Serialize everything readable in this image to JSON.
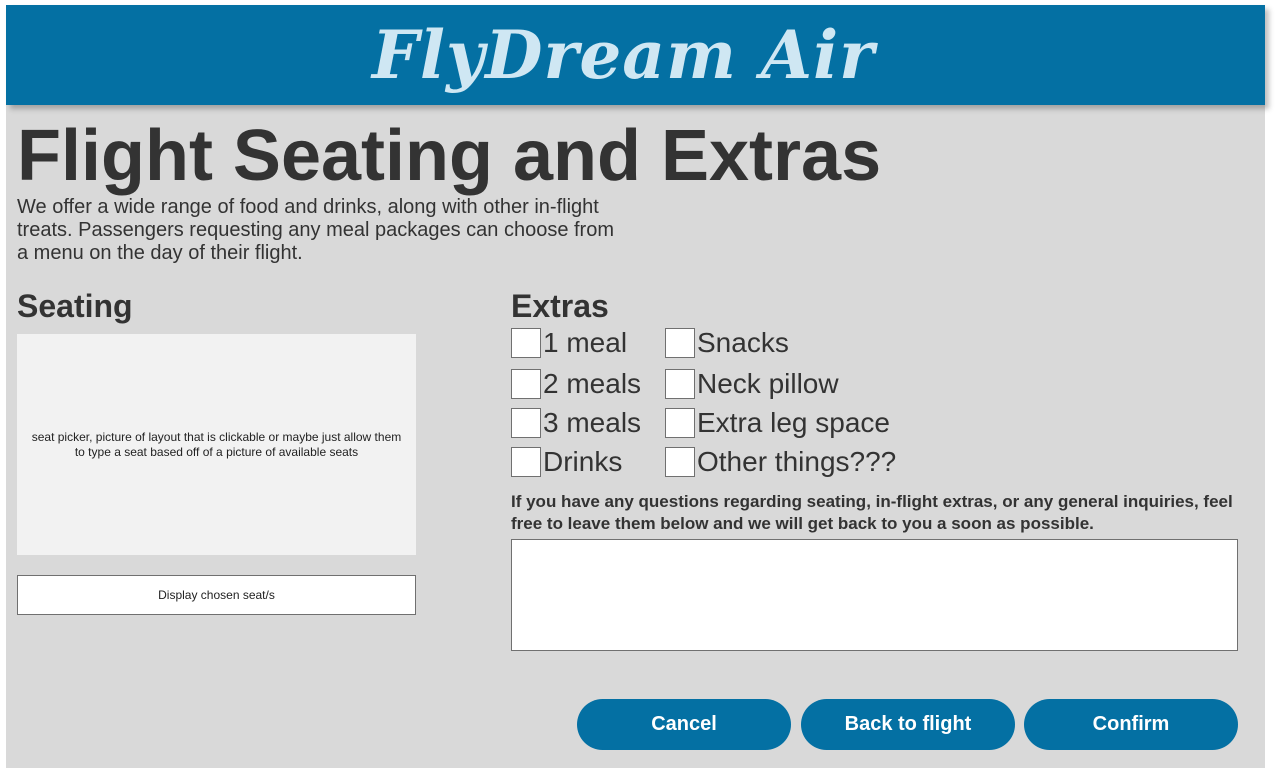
{
  "brand": "FlyDream Air",
  "page_title": "Flight Seating and Extras",
  "intro": "We offer a wide range of food and drinks, along with other in-flight treats. Passengers requesting any meal packages can choose from a menu on the day of their flight.",
  "seating": {
    "title": "Seating",
    "picker_text": "seat picker, picture of layout that is clickable or maybe just allow them to type a seat based off of a picture of available seats",
    "display_button": "Display chosen seat/s"
  },
  "extras": {
    "title": "Extras",
    "items": [
      "1 meal",
      "Snacks",
      "2 meals",
      "Neck pillow",
      "3 meals",
      "Extra leg space",
      "Drinks",
      "Other things???"
    ]
  },
  "inquiry": {
    "prompt": "If you have any questions regarding seating, in-flight extras, or any general inquiries, feel free to leave them below and we will get back to you a soon as possible.",
    "value": ""
  },
  "buttons": {
    "cancel": "Cancel",
    "back": "Back to flight",
    "confirm": "Confirm"
  },
  "colors": {
    "brand_blue": "#0470a3",
    "background": "#d9d9d9",
    "logo_text": "#cfe7f3"
  }
}
